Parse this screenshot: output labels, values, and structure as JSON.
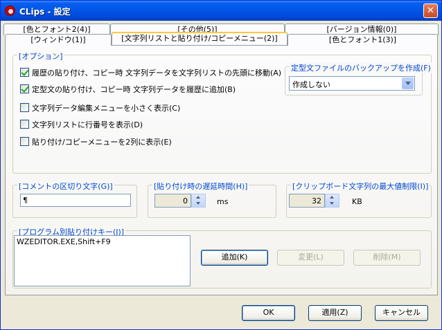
{
  "window": {
    "title": "CLips - 設定",
    "close_glyph": "✕"
  },
  "tabs": {
    "row_back": [
      "[色とフォント2(4)]",
      "[その他(5)]",
      "[バージョン情報(0)]"
    ],
    "row_front": [
      "[ウィンドウ(1)]",
      "[文字列リストと貼り付け/コピーメニュー(2)]",
      "[色とフォント1(3)]"
    ],
    "active_index": 1
  },
  "options": {
    "legend": "[オプション]",
    "checks": [
      {
        "label": "履歴の貼り付け、コピー時 文字列データを文字列リストの先頭に移動(A)",
        "checked": true
      },
      {
        "label": "定型文の貼り付け、コピー時 文字列データを履歴に追加(B)",
        "checked": true
      },
      {
        "label": "文字列データ編集メニューを小さく表示(C)",
        "checked": false
      },
      {
        "label": "文字列リストに行番号を表示(D)",
        "checked": false
      },
      {
        "label": "貼り付け/コピーメニューを2列に表示(E)",
        "checked": false
      }
    ],
    "backup": {
      "legend": "定型文ファイルのバックアップを作成(F)",
      "selected": "作成しない"
    }
  },
  "comment_sep": {
    "legend": "[コメントの区切り文字(G)]",
    "value": "¶"
  },
  "paste_delay": {
    "legend": "[貼り付け時の遅延時間(H)]",
    "value": "0",
    "unit": "ms"
  },
  "clipboard_limit": {
    "legend": "[クリップボード文字列の最大値制限(I)]",
    "value": "32",
    "unit": "KB"
  },
  "program_keys": {
    "legend": "[プログラム別貼り付けキー(J)]",
    "items": [
      "WZEDITOR.EXE,Shift+F9"
    ],
    "add_label": "追加(K)",
    "change_label": "変更(L)",
    "delete_label": "削除(M)"
  },
  "footer": {
    "ok_label": "OK",
    "apply_label": "適用(Z)",
    "cancel_label": "キャンセル"
  },
  "colors": {
    "titlebar": "#0055e5",
    "legend_text": "#0046d5",
    "active_tab_accent": "#ffc83c"
  }
}
